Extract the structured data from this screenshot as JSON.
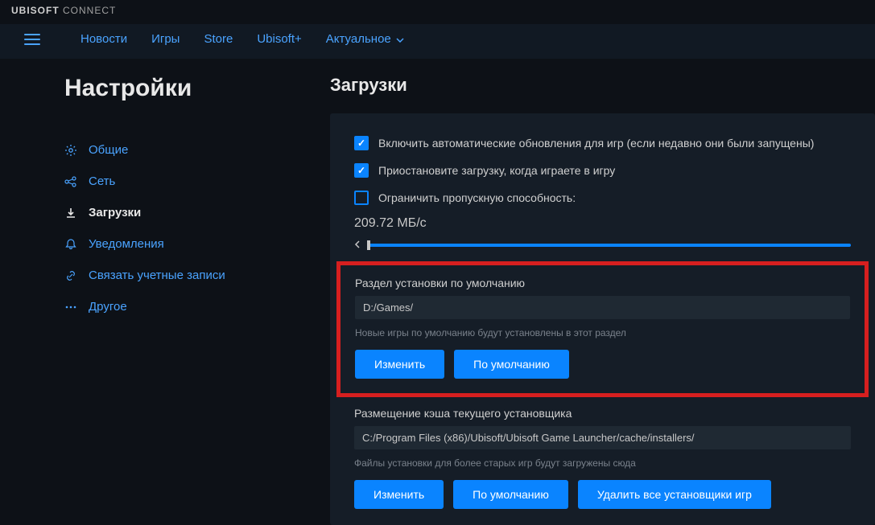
{
  "titlebar": {
    "brand_bold": "UBISOFT",
    "brand_light": "CONNECT"
  },
  "nav": {
    "items": [
      {
        "label": "Новости"
      },
      {
        "label": "Игры"
      },
      {
        "label": "Store"
      },
      {
        "label": "Ubisoft+"
      },
      {
        "label": "Актуальное"
      }
    ]
  },
  "sidebar": {
    "title": "Настройки",
    "items": [
      {
        "label": "Общие"
      },
      {
        "label": "Сеть"
      },
      {
        "label": "Загрузки"
      },
      {
        "label": "Уведомления"
      },
      {
        "label": "Связать учетные записи"
      },
      {
        "label": "Другое"
      }
    ]
  },
  "main": {
    "heading": "Загрузки",
    "checkboxes": [
      {
        "label": "Включить автоматические обновления для игр (если недавно они были запущены)",
        "checked": true
      },
      {
        "label": "Приостановите загрузку, когда играете в игру",
        "checked": true
      },
      {
        "label": "Ограничить пропускную способность:",
        "checked": false
      }
    ],
    "bandwidth_value": "209.72 МБ/с",
    "install_section": {
      "label": "Раздел установки по умолчанию",
      "path": "D:/Games/",
      "hint": "Новые игры по умолчанию будут установлены в этот раздел",
      "change_btn": "Изменить",
      "default_btn": "По умолчанию"
    },
    "cache_section": {
      "label": "Размещение кэша текущего установщика",
      "path": "C:/Program Files (x86)/Ubisoft/Ubisoft Game Launcher/cache/installers/",
      "hint": "Файлы установки для более старых игр будут загружены сюда",
      "change_btn": "Изменить",
      "default_btn": "По умолчанию",
      "delete_btn": "Удалить все установщики игр"
    }
  }
}
